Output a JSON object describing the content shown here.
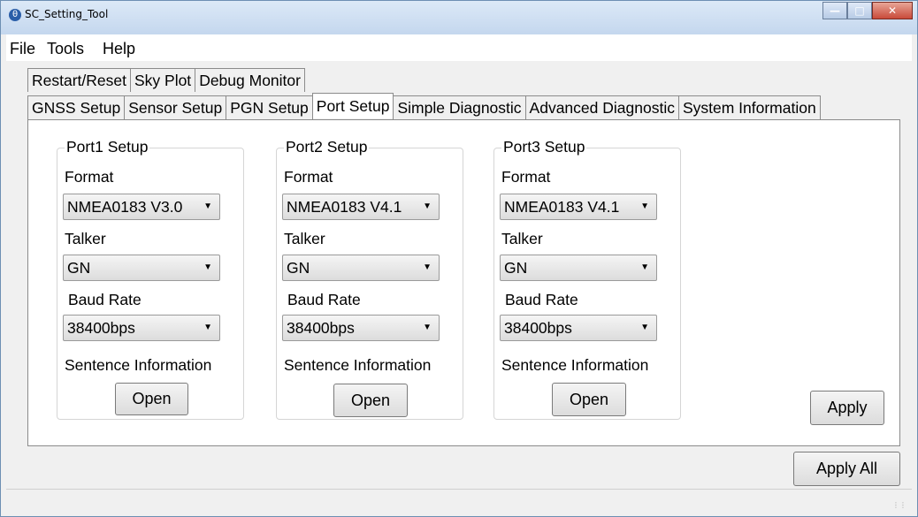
{
  "window": {
    "title": "SC_Setting_Tool",
    "icon": "app-icon"
  },
  "menu": [
    "File",
    "Tools",
    "Help"
  ],
  "tabs_row1": [
    "Restart/Reset",
    "Sky Plot",
    "Debug Monitor"
  ],
  "tabs_row2": [
    "GNSS Setup",
    "Sensor Setup",
    "PGN Setup",
    "Port Setup",
    "Simple Diagnostic",
    "Advanced Diagnostic",
    "System Information"
  ],
  "active_tab": "Port Setup",
  "ports": [
    {
      "title": "Port1 Setup",
      "format_label": "Format",
      "format": "NMEA0183 V3.0",
      "talker_label": "Talker",
      "talker": "GN",
      "baud_label": "Baud Rate",
      "baud": "38400bps",
      "sentence_label": "Sentence Information",
      "open_label": "Open"
    },
    {
      "title": "Port2 Setup",
      "format_label": "Format",
      "format": "NMEA0183 V4.1",
      "talker_label": "Talker",
      "talker": "GN",
      "baud_label": "Baud Rate",
      "baud": "38400bps",
      "sentence_label": "Sentence Information",
      "open_label": "Open"
    },
    {
      "title": "Port3 Setup",
      "format_label": "Format",
      "format": "NMEA0183 V4.1",
      "talker_label": "Talker",
      "talker": "GN",
      "baud_label": "Baud Rate",
      "baud": "38400bps",
      "sentence_label": "Sentence Information",
      "open_label": "Open"
    }
  ],
  "apply_label": "Apply",
  "apply_all_label": "Apply All"
}
